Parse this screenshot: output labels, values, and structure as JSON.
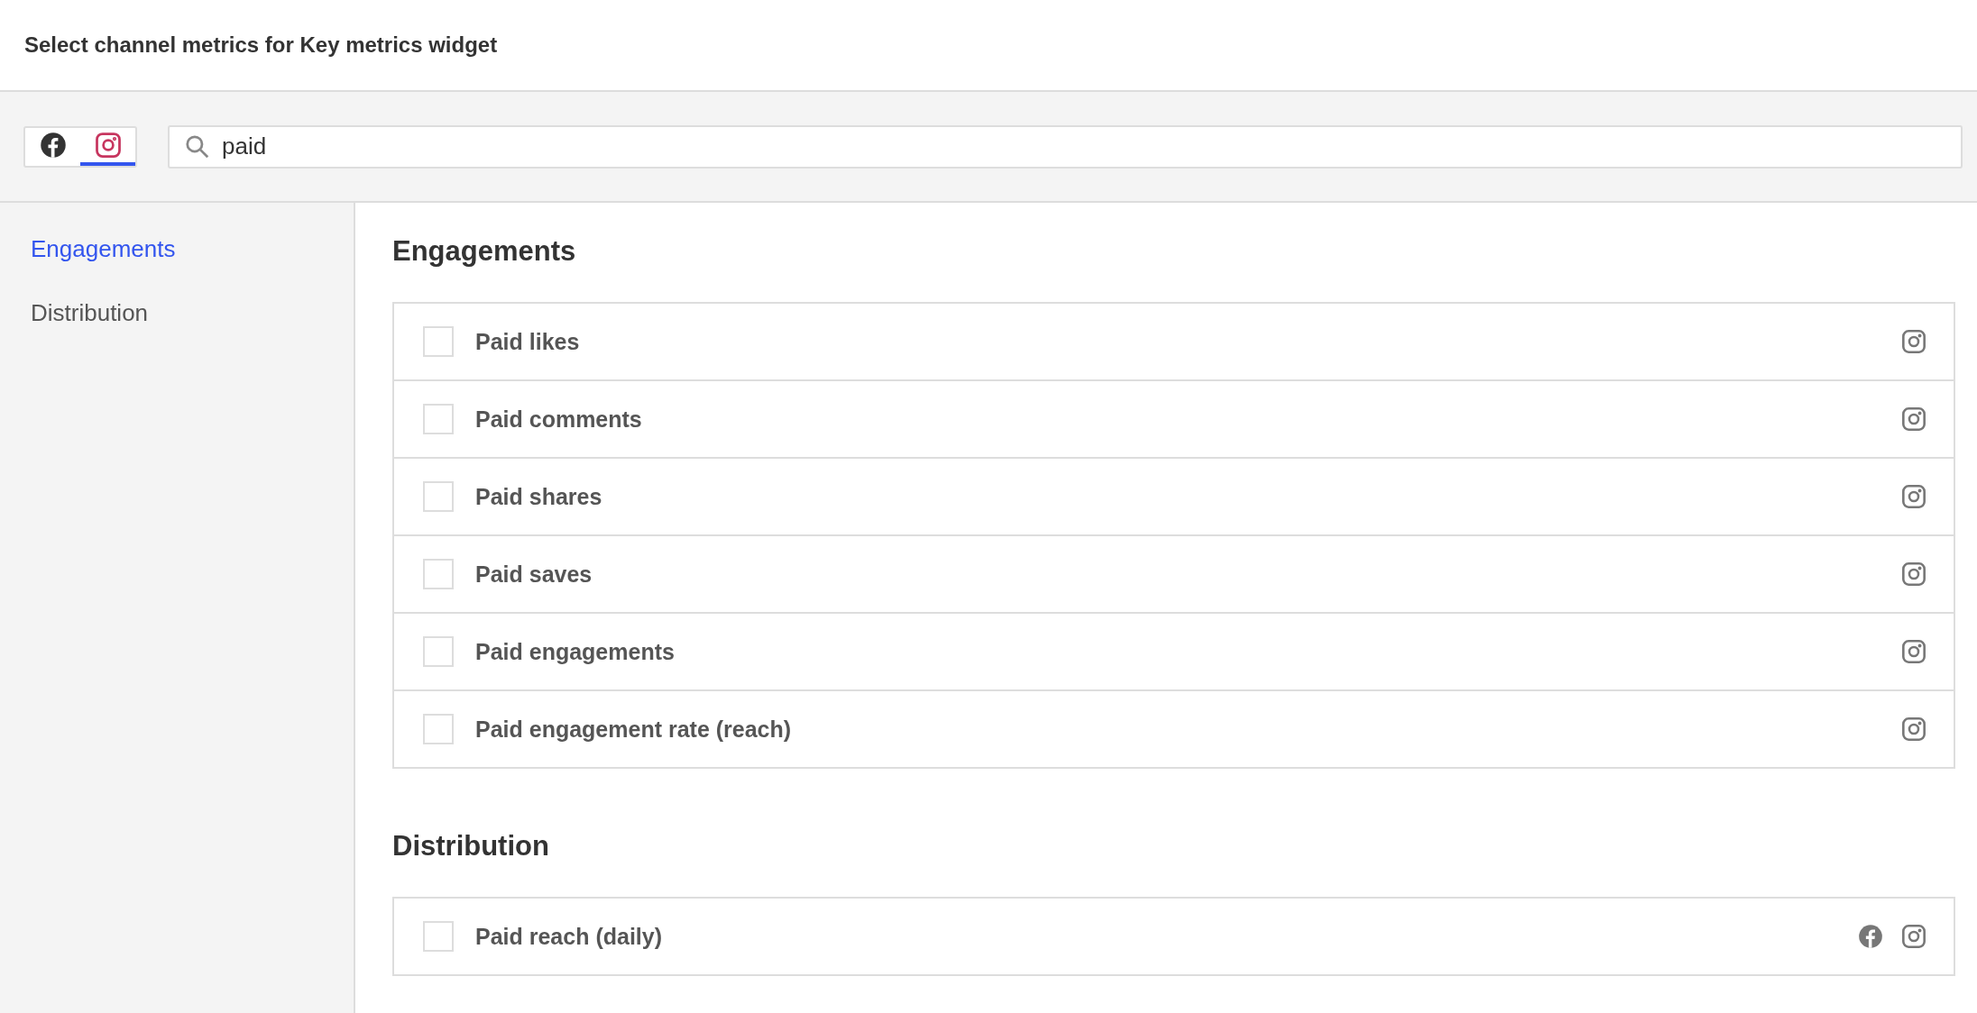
{
  "header": {
    "title": "Select channel metrics for Key metrics widget"
  },
  "channel_filter": [
    {
      "kind": "facebook",
      "selected": false
    },
    {
      "kind": "instagram",
      "selected": true
    }
  ],
  "search": {
    "value": "paid"
  },
  "sidebar": {
    "items": [
      {
        "label": "Engagements",
        "selected": true
      },
      {
        "label": "Distribution",
        "selected": false
      }
    ]
  },
  "sections": [
    {
      "title": "Engagements",
      "metrics": [
        {
          "label": "Paid likes",
          "checked": false,
          "channels": [
            {
              "kind": "instagram"
            }
          ]
        },
        {
          "label": "Paid comments",
          "checked": false,
          "channels": [
            {
              "kind": "instagram"
            }
          ]
        },
        {
          "label": "Paid shares",
          "checked": false,
          "channels": [
            {
              "kind": "instagram"
            }
          ]
        },
        {
          "label": "Paid saves",
          "checked": false,
          "channels": [
            {
              "kind": "instagram"
            }
          ]
        },
        {
          "label": "Paid engagements",
          "checked": false,
          "channels": [
            {
              "kind": "instagram"
            }
          ]
        },
        {
          "label": "Paid engagement rate (reach)",
          "checked": false,
          "channels": [
            {
              "kind": "instagram"
            }
          ]
        }
      ]
    },
    {
      "title": "Distribution",
      "metrics": [
        {
          "label": "Paid reach (daily)",
          "checked": false,
          "channels": [
            {
              "kind": "facebook"
            },
            {
              "kind": "instagram"
            }
          ]
        }
      ]
    }
  ]
}
